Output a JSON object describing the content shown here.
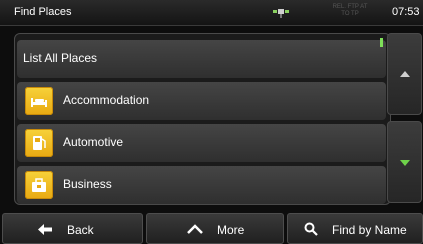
{
  "status_bar": {
    "title": "Find Places",
    "clock": "07:53",
    "gps_info": "REL. FTP AT TO TP"
  },
  "list": {
    "header_item": "List All Places",
    "items": [
      {
        "label": "Accommodation",
        "icon": "bed-icon"
      },
      {
        "label": "Automotive",
        "icon": "fuel-pump-icon"
      },
      {
        "label": "Business",
        "icon": "briefcase-icon"
      }
    ]
  },
  "scroll": {
    "up_icon": "triangle-up-icon",
    "down_icon": "triangle-down-icon"
  },
  "bottom_bar": {
    "back_label": "Back",
    "more_label": "More",
    "find_by_name_label": "Find by Name"
  },
  "colors": {
    "accent_green": "#7fe05a",
    "category_icon_yellow": "#f2c01f",
    "background": "#0d0d0d"
  }
}
